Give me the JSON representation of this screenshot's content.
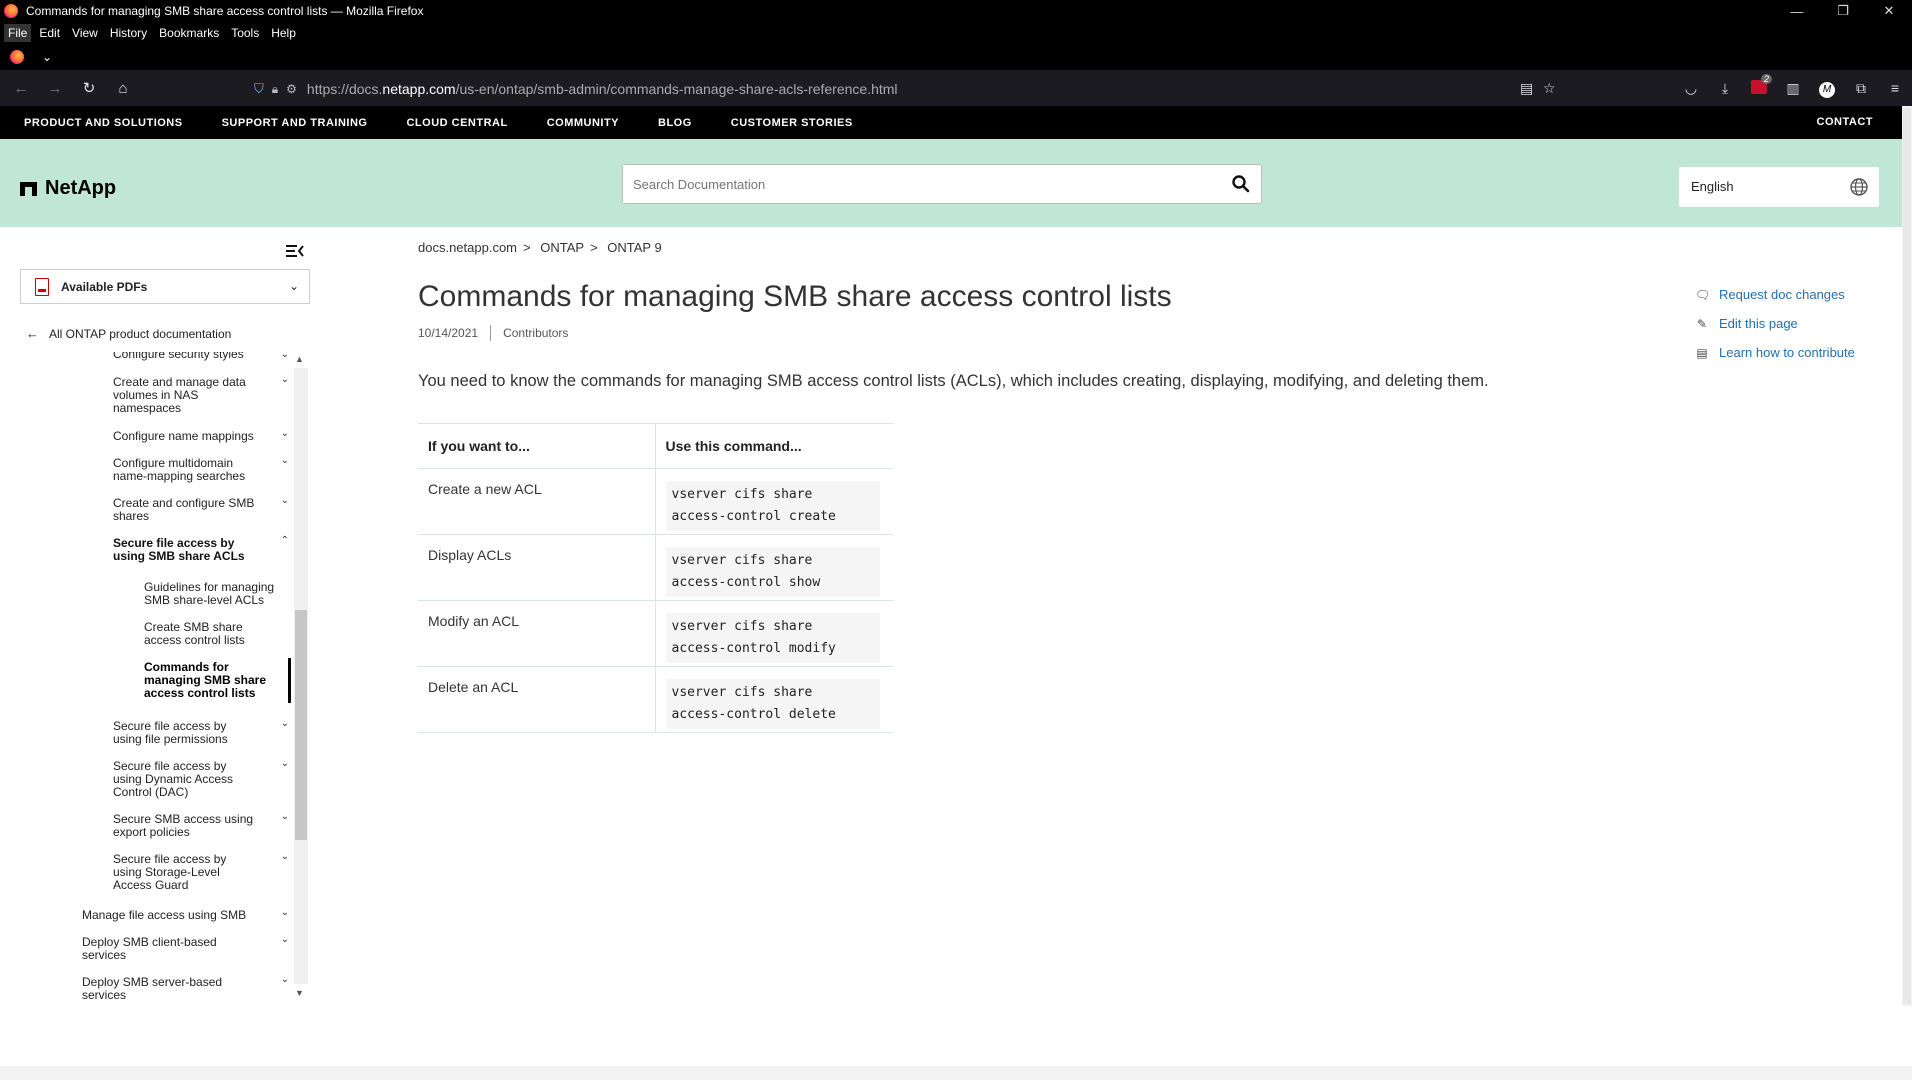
{
  "window": {
    "title": "Commands for managing SMB share access control lists — Mozilla Firefox",
    "controls": {
      "minimize": "—",
      "restore": "❐",
      "close": "✕"
    }
  },
  "menubar": [
    "File",
    "Edit",
    "View",
    "History",
    "Bookmarks",
    "Tools",
    "Help"
  ],
  "addressbar": {
    "url_prefix": "https://docs.",
    "url_domain": "netapp.com",
    "url_suffix": "/us-en/ontap/smb-admin/commands-manage-share-acls-reference.html"
  },
  "toolbar": {
    "ublock_badge": "2",
    "account_initial": "M"
  },
  "sitenav": {
    "items": [
      "PRODUCT AND SOLUTIONS",
      "SUPPORT AND TRAINING",
      "CLOUD CENTRAL",
      "COMMUNITY",
      "BLOG",
      "CUSTOMER STORIES"
    ],
    "contact": "CONTACT"
  },
  "header": {
    "brand": "NetApp",
    "search_placeholder": "Search Documentation",
    "language": "English"
  },
  "sidebar": {
    "pdfs_label": "Available PDFs",
    "back_link": "All ONTAP product documentation",
    "items": [
      {
        "label": "Configure security styles"
      },
      {
        "label": "Create and manage data volumes in NAS namespaces"
      },
      {
        "label": "Configure name mappings"
      },
      {
        "label": "Configure multidomain name-mapping searches"
      },
      {
        "label": "Create and configure SMB shares"
      },
      {
        "label": "Secure file access by using SMB share ACLs"
      },
      {
        "label": "Guidelines for managing SMB share-level ACLs"
      },
      {
        "label": "Create SMB share access control lists"
      },
      {
        "label": "Commands for managing SMB share access control lists"
      },
      {
        "label": "Secure file access by using file permissions"
      },
      {
        "label": "Secure file access by using Dynamic Access Control (DAC)"
      },
      {
        "label": "Secure SMB access using export policies"
      },
      {
        "label": "Secure file access by using Storage-Level Access Guard"
      },
      {
        "label": "Manage file access using SMB"
      },
      {
        "label": "Deploy SMB client-based services"
      },
      {
        "label": "Deploy SMB server-based services"
      }
    ]
  },
  "breadcrumb": [
    "docs.netapp.com",
    "ONTAP",
    "ONTAP 9"
  ],
  "breadcrumb_sep": ">",
  "article": {
    "title": "Commands for managing SMB share access control lists",
    "date": "10/14/2021",
    "contributors": "Contributors",
    "intro": "You need to know the commands for managing SMB access control lists (ACLs), which includes creating, displaying, modifying, and deleting them.",
    "table": {
      "headers": [
        "If you want to...",
        "Use this command..."
      ],
      "rows": [
        {
          "action": "Create a new ACL",
          "command": "vserver cifs share access-control create"
        },
        {
          "action": "Display ACLs",
          "command": "vserver cifs share access-control show"
        },
        {
          "action": "Modify an ACL",
          "command": "vserver cifs share access-control modify"
        },
        {
          "action": "Delete an ACL",
          "command": "vserver cifs share access-control delete"
        }
      ]
    }
  },
  "rail": {
    "links": [
      "Request doc changes",
      "Edit this page",
      "Learn how to contribute"
    ]
  }
}
